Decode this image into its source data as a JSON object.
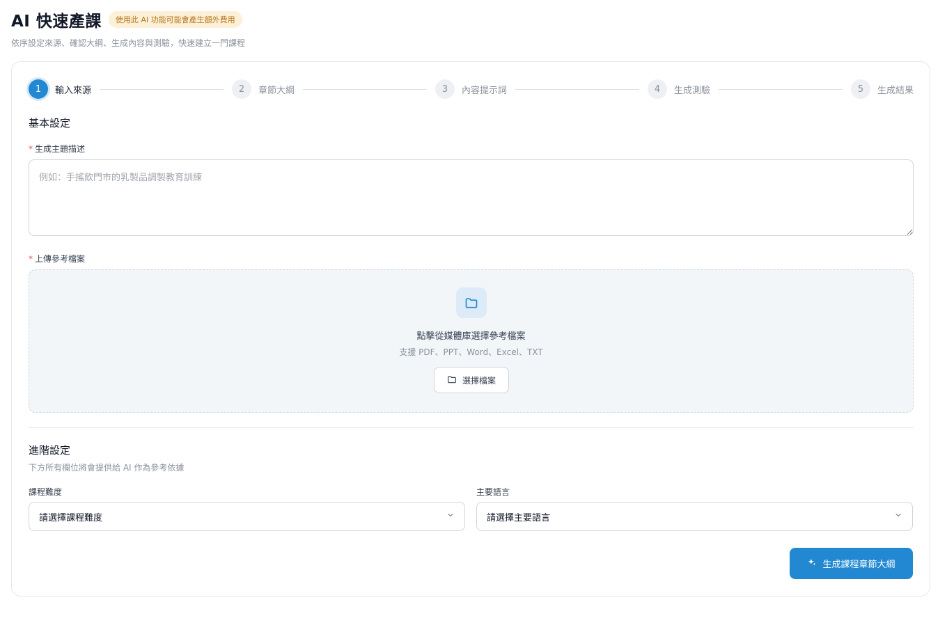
{
  "header": {
    "title": "AI 快速產課",
    "badge": "使用此 AI 功能可能會產生額外費用",
    "subtitle": "依序設定來源、確認大綱、生成內容與測驗，快速建立一門課程"
  },
  "stepper": {
    "current_step": 1,
    "steps": [
      {
        "number": "1",
        "label": "輸入來源"
      },
      {
        "number": "2",
        "label": "章節大綱"
      },
      {
        "number": "3",
        "label": "內容提示詞"
      },
      {
        "number": "4",
        "label": "生成測驗"
      },
      {
        "number": "5",
        "label": "生成結果"
      }
    ]
  },
  "basic": {
    "title": "基本設定",
    "topic_label": "生成主題描述",
    "topic_placeholder": "例如：手搖飲門市的乳製品調製教育訓練",
    "topic_value": "",
    "required_mark": "*",
    "upload_label": "上傳參考檔案",
    "upload_title": "點擊從媒體庫選擇參考檔案",
    "upload_hint": "支援 PDF、PPT、Word、Excel、TXT",
    "upload_button": "選擇檔案"
  },
  "advanced": {
    "title": "進階設定",
    "description": "下方所有欄位將會提供給 AI 作為參考依據",
    "difficulty_label": "課程難度",
    "difficulty_value": "請選擇課程難度",
    "language_label": "主要語言",
    "language_value": "請選擇主要語言"
  },
  "actions": {
    "generate_label": "生成課程章節大綱"
  },
  "colors": {
    "accent": "#2188d1",
    "badge_bg": "#fdf0d8",
    "badge_text": "#b7791f",
    "required": "#e05252"
  },
  "icons": {
    "dropzone": "folder-icon",
    "upload_button": "folder-icon",
    "select": "chevron-down-icon",
    "generate": "sparkle-icon"
  }
}
